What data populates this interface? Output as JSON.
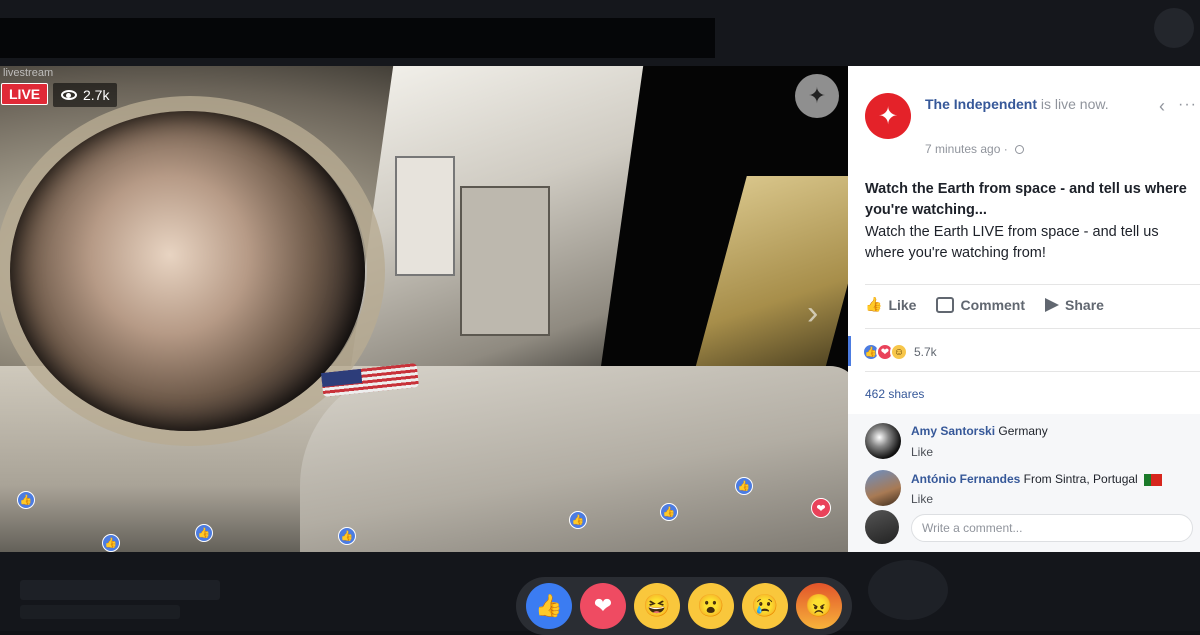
{
  "video": {
    "watermark": "livestream",
    "live_label": "LIVE",
    "viewers": "2.7k",
    "publisher_logo_icon": "eagle-icon"
  },
  "post": {
    "page_name": "The Independent",
    "status_text": " is live now.",
    "timestamp": "7 minutes ago · ",
    "title": "Watch the Earth from space - and tell us where you're watching...",
    "body": "Watch the Earth LIVE from space - and tell us where you're watching from!",
    "actions": {
      "like": "Like",
      "comment": "Comment",
      "share": "Share"
    },
    "reaction_count": "5.7k",
    "shares": "462 shares"
  },
  "comments": [
    {
      "name": "Amy Santorski",
      "text": " Germany",
      "like": "Like"
    },
    {
      "name": "António Fernandes",
      "text": " From Sintra, Portugal",
      "like": "Like"
    }
  ],
  "write_comment_placeholder": "Write a comment...",
  "colors": {
    "accent_blue": "#4c7ce1",
    "live_red": "#e02a37",
    "link_blue": "#365899",
    "independent_red": "#e42229"
  }
}
